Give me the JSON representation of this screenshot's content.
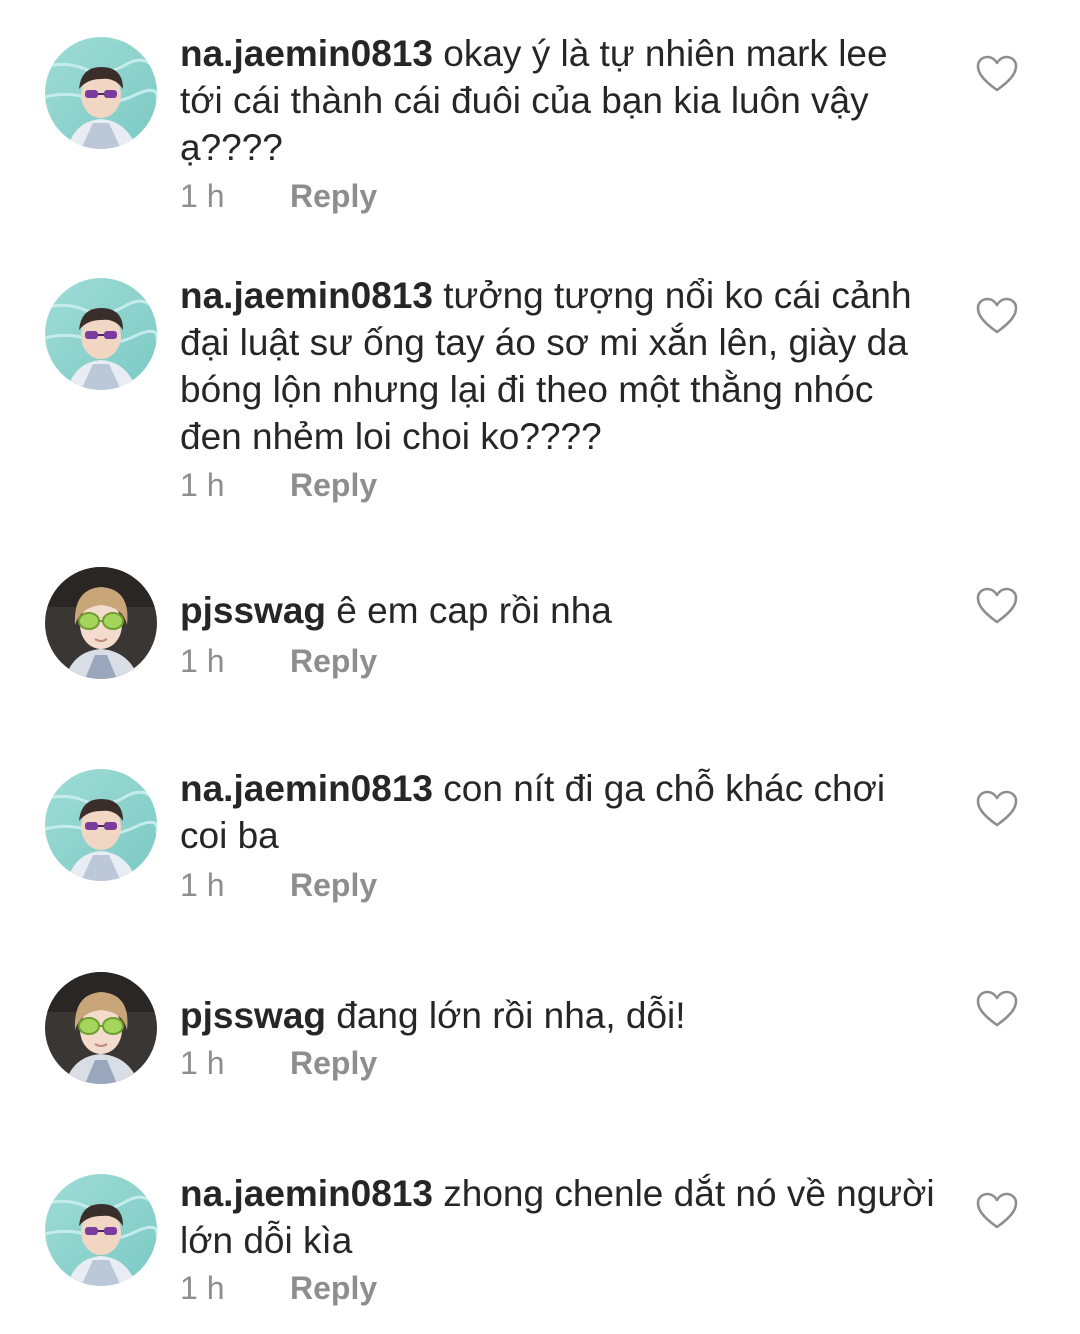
{
  "colors": {
    "text": "#262626",
    "secondary": "#8e8e8e",
    "background": "#ffffff"
  },
  "icons": {
    "like": "heart-outline-icon"
  },
  "comments": [
    {
      "username": "na.jaemin0813",
      "text": "okay ý là tự nhiên mark lee tới cái thành cái đuôi của bạn kia luôn vậy ạ????",
      "time": "1 h",
      "reply_label": "Reply",
      "avatar": "jaemin"
    },
    {
      "username": "na.jaemin0813",
      "text": "tưởng tượng nổi ko cái cảnh đại luật sư ống tay áo sơ mi xắn lên, giày da bóng lộn nhưng lại đi theo một thằng nhóc đen nhẻm loi choi ko????",
      "time": "1 h",
      "reply_label": "Reply",
      "avatar": "jaemin"
    },
    {
      "username": "pjsswag",
      "text": "ê em cap rồi nha",
      "time": "1 h",
      "reply_label": "Reply",
      "avatar": "pjsswag"
    },
    {
      "username": "na.jaemin0813",
      "text": "con nít đi ga chỗ khác chơi coi ba",
      "time": "1 h",
      "reply_label": "Reply",
      "avatar": "jaemin"
    },
    {
      "username": "pjsswag",
      "text": "đang lớn rồi nha, dỗi!",
      "time": "1 h",
      "reply_label": "Reply",
      "avatar": "pjsswag"
    },
    {
      "username": "na.jaemin0813",
      "text": "zhong chenle dắt nó về người lớn dỗi kìa",
      "time": "1 h",
      "reply_label": "Reply",
      "avatar": "jaemin"
    }
  ]
}
